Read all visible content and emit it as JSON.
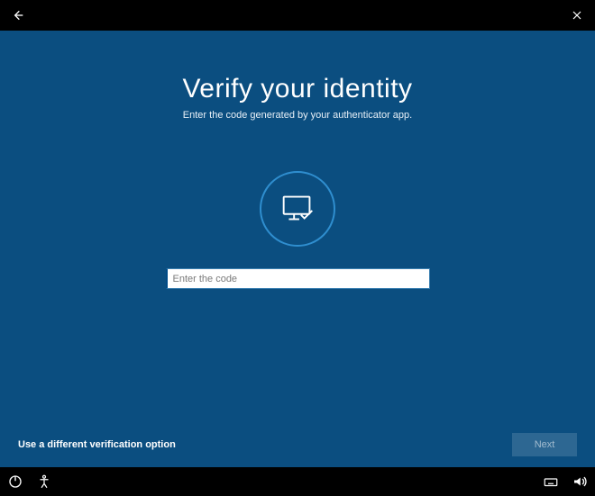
{
  "header": {
    "title": "Verify your identity",
    "subtitle": "Enter the code generated by your authenticator app."
  },
  "input": {
    "placeholder": "Enter the code",
    "value": ""
  },
  "actions": {
    "alt_link": "Use a different verification option",
    "next_label": "Next"
  },
  "icons": {
    "back": "back-arrow",
    "close": "close-x",
    "hero": "monitor-check",
    "ease_of_access": "ease-of-access",
    "power": "power",
    "keyboard": "keyboard",
    "volume": "volume"
  }
}
